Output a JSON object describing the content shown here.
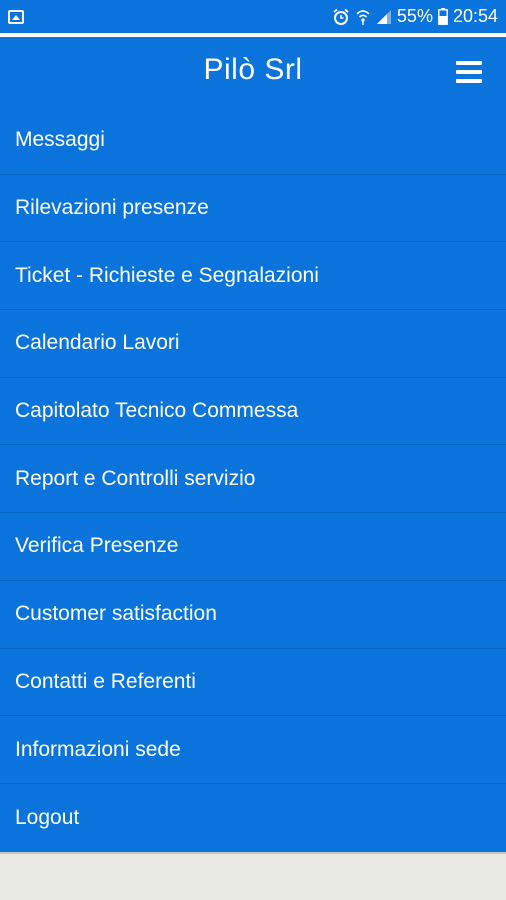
{
  "status_bar": {
    "battery": "55%",
    "time": "20:54",
    "icons": [
      "gallery-icon",
      "alarm-icon",
      "wifi-icon",
      "signal-icon",
      "battery-icon"
    ]
  },
  "header": {
    "title": "Pilò Srl",
    "menu_icon": "hamburger-menu-icon"
  },
  "menu": {
    "items": [
      {
        "label": "Messaggi"
      },
      {
        "label": "Rilevazioni presenze"
      },
      {
        "label": "Ticket - Richieste e Segnalazioni"
      },
      {
        "label": "Calendario Lavori"
      },
      {
        "label": "Capitolato Tecnico Commessa"
      },
      {
        "label": "Report e Controlli servizio"
      },
      {
        "label": "Verifica Presenze"
      },
      {
        "label": "Customer satisfaction"
      },
      {
        "label": "Contatti e Referenti"
      },
      {
        "label": "Informazioni sede"
      },
      {
        "label": "Logout"
      }
    ]
  },
  "colors": {
    "primary": "#0a73dc",
    "divider": "#0864c2",
    "background": "#e9e9e4"
  }
}
